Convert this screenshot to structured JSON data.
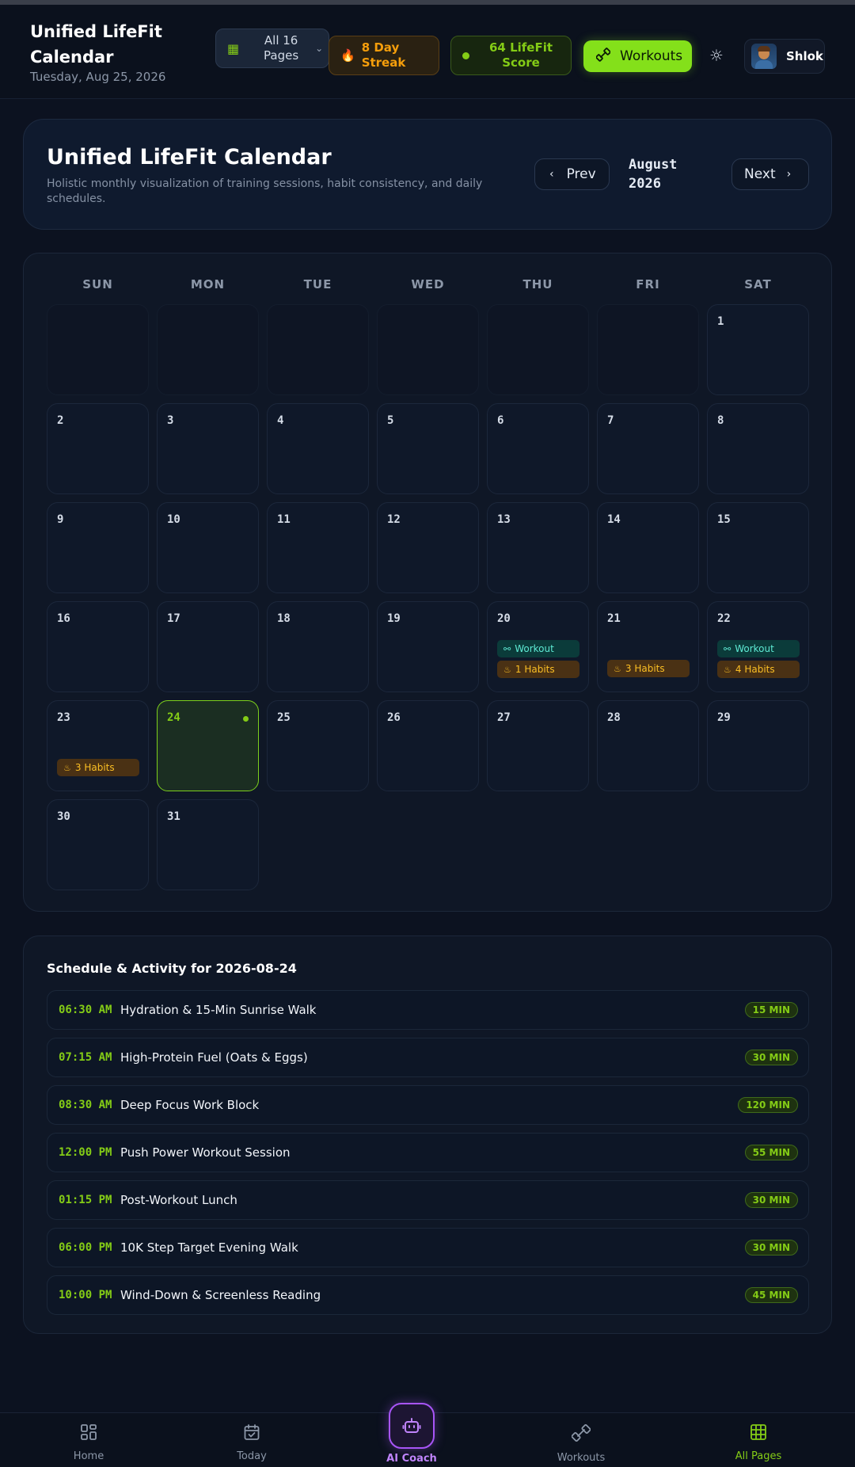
{
  "header": {
    "title": "Unified LifeFit Calendar",
    "date": "Tuesday, Aug 25, 2026",
    "pages_selector": "All 16 Pages",
    "streak": "8 Day Streak",
    "score": "64 LifeFit Score",
    "workouts_button": "Workouts",
    "user_name": "Shlok"
  },
  "hero": {
    "title": "Unified LifeFit Calendar",
    "subtitle": "Holistic monthly visualization of training sessions, habit consistency, and daily schedules.",
    "prev_label": "Prev",
    "next_label": "Next",
    "month": "August",
    "year": "2026"
  },
  "calendar": {
    "weekdays": [
      "SUN",
      "MON",
      "TUE",
      "WED",
      "THU",
      "FRI",
      "SAT"
    ],
    "leading_empty": 6,
    "today": 24,
    "days": [
      {
        "day": "1"
      },
      {
        "day": "2"
      },
      {
        "day": "3"
      },
      {
        "day": "4"
      },
      {
        "day": "5"
      },
      {
        "day": "6"
      },
      {
        "day": "7"
      },
      {
        "day": "8"
      },
      {
        "day": "9"
      },
      {
        "day": "10"
      },
      {
        "day": "11"
      },
      {
        "day": "12"
      },
      {
        "day": "13"
      },
      {
        "day": "14"
      },
      {
        "day": "15"
      },
      {
        "day": "16"
      },
      {
        "day": "17"
      },
      {
        "day": "18"
      },
      {
        "day": "19"
      },
      {
        "day": "20",
        "workout": "Workout",
        "habits": "1 Habits"
      },
      {
        "day": "21",
        "habits": "3 Habits"
      },
      {
        "day": "22",
        "workout": "Workout",
        "habits": "4 Habits"
      },
      {
        "day": "23",
        "habits": "3 Habits"
      },
      {
        "day": "24"
      },
      {
        "day": "25"
      },
      {
        "day": "26"
      },
      {
        "day": "27"
      },
      {
        "day": "28"
      },
      {
        "day": "29"
      },
      {
        "day": "30"
      },
      {
        "day": "31"
      }
    ]
  },
  "schedule": {
    "title": "Schedule & Activity for 2026-08-24",
    "items": [
      {
        "time": "06:30 AM",
        "title": "Hydration & 15-Min Sunrise Walk",
        "duration": "15 MIN"
      },
      {
        "time": "07:15 AM",
        "title": "High-Protein Fuel (Oats & Eggs)",
        "duration": "30 MIN"
      },
      {
        "time": "08:30 AM",
        "title": "Deep Focus Work Block",
        "duration": "120 MIN"
      },
      {
        "time": "12:00 PM",
        "title": "Push Power Workout Session",
        "duration": "55 MIN"
      },
      {
        "time": "01:15 PM",
        "title": "Post-Workout Lunch",
        "duration": "30 MIN"
      },
      {
        "time": "06:00 PM",
        "title": "10K Step Target Evening Walk",
        "duration": "30 MIN"
      },
      {
        "time": "10:00 PM",
        "title": "Wind-Down & Screenless Reading",
        "duration": "45 MIN"
      }
    ]
  },
  "bottom_nav": {
    "home": "Home",
    "today": "Today",
    "ai_coach": "AI Coach",
    "workouts": "Workouts",
    "all_pages": "All Pages"
  },
  "colors": {
    "accent": "#84cc16",
    "streak": "#f59e0b",
    "ai": "#a855f7",
    "background": "#0c1220"
  }
}
